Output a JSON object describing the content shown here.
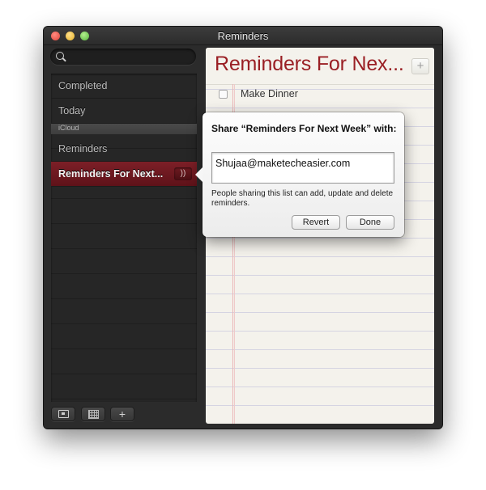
{
  "window": {
    "title": "Reminders"
  },
  "sidebar": {
    "search": {
      "value": "",
      "placeholder": ""
    },
    "items": [
      {
        "label": "Completed"
      },
      {
        "label": "Today"
      }
    ],
    "group": "iCloud",
    "group_items": [
      {
        "label": "Reminders"
      },
      {
        "label": "Reminders For Next..."
      }
    ],
    "selected_index": 1,
    "share_icon": "wifi-share-icon",
    "bottom_buttons": [
      {
        "icon": "show-calendar-icon"
      },
      {
        "icon": "calendar-grid-icon"
      },
      {
        "icon": "plus-icon",
        "label": "+"
      }
    ]
  },
  "main": {
    "title": "Reminders For Nex...",
    "add_label": "+",
    "items": [
      {
        "title": "Make Dinner",
        "checked": false
      }
    ]
  },
  "share_popover": {
    "title": "Share “Reminders For Next Week” with:",
    "email": "Shujaa@maketecheasier.com",
    "note": "People sharing this list can add, update and delete reminders.",
    "revert_label": "Revert",
    "done_label": "Done"
  },
  "colors": {
    "accent_red": "#9a1f24",
    "selected_row": "#7d1f27",
    "sidebar_bg": "#2b2b2b",
    "paper": "#f4f2ec"
  }
}
